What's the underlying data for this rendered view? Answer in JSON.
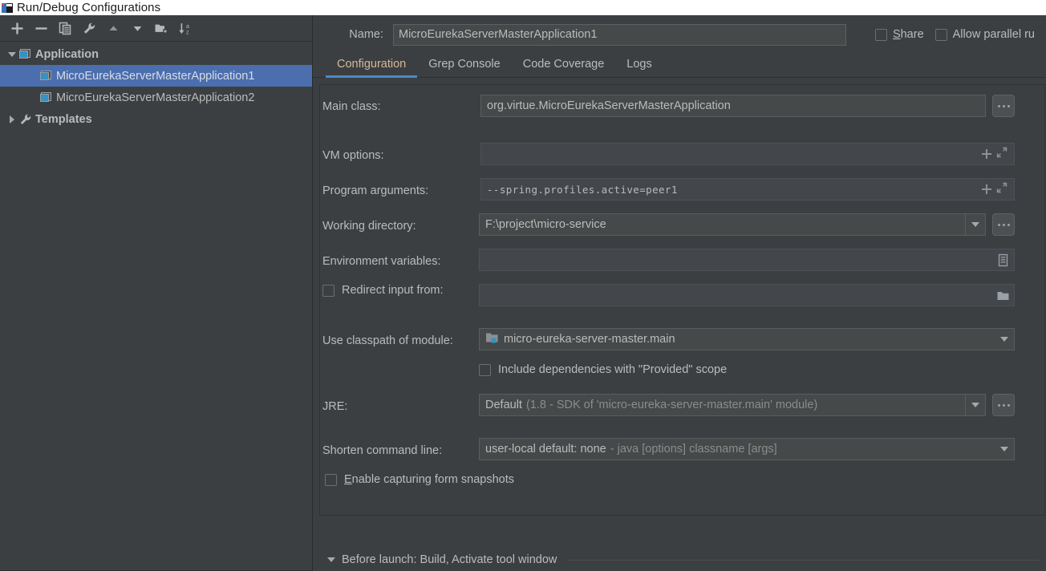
{
  "window": {
    "title": "Run/Debug Configurations",
    "icon": "intellij-idea-icon"
  },
  "toolbar": {
    "buttons": [
      {
        "name": "add-configuration-button",
        "icon": "plus-icon"
      },
      {
        "name": "remove-configuration-button",
        "icon": "minus-icon"
      },
      {
        "name": "copy-configuration-button",
        "icon": "copy-icon"
      },
      {
        "name": "edit-templates-button",
        "icon": "wrench-icon"
      },
      {
        "name": "move-up-button",
        "icon": "arrow-up-icon"
      },
      {
        "name": "move-down-button",
        "icon": "arrow-down-icon"
      },
      {
        "name": "create-folder-button",
        "icon": "folder-add-icon"
      },
      {
        "name": "sort-configurations-button",
        "icon": "sort-az-icon"
      }
    ]
  },
  "tree": {
    "nodes": [
      {
        "label": "Application",
        "type": "group",
        "expanded": true,
        "icon": "application-icon",
        "bold": true
      },
      {
        "label": "MicroEurekaServerMasterApplication1",
        "type": "config",
        "selected": true,
        "icon": "application-icon"
      },
      {
        "label": "MicroEurekaServerMasterApplication2",
        "type": "config",
        "selected": false,
        "icon": "application-icon"
      },
      {
        "label": "Templates",
        "type": "group",
        "expanded": false,
        "icon": "wrench-icon",
        "bold": true
      }
    ]
  },
  "header": {
    "name_label": "Name:",
    "name_value": "MicroEurekaServerMasterApplication1",
    "share_label": "Share",
    "share_mnemonic": "S",
    "share_checked": false,
    "parallel_label": "Allow parallel ru",
    "parallel_checked": false
  },
  "tabs": [
    {
      "label": "Configuration",
      "active": true
    },
    {
      "label": "Grep Console",
      "active": false
    },
    {
      "label": "Code Coverage",
      "active": false
    },
    {
      "label": "Logs",
      "active": false
    }
  ],
  "form": {
    "main_class_label": "Main class:",
    "main_class_value": "org.virtue.MicroEurekaServerMasterApplication",
    "vm_options_label": "VM options:",
    "vm_options_value": "",
    "program_arguments_label": "Program arguments:",
    "program_arguments_value": "--spring.profiles.active=peer1",
    "working_directory_label": "Working directory:",
    "working_directory_value": "F:\\project\\micro-service",
    "environment_variables_label": "Environment variables:",
    "environment_variables_value": "",
    "redirect_input_label": "Redirect input from:",
    "redirect_input_checked": false,
    "redirect_input_value": "",
    "classpath_module_label": "Use classpath of module:",
    "classpath_module_value": "micro-eureka-server-master.main",
    "include_provided_label": "Include dependencies with \"Provided\" scope",
    "include_provided_checked": false,
    "jre_label": "JRE:",
    "jre_value_main": "Default",
    "jre_value_detail": "(1.8 - SDK of 'micro-eureka-server-master.main' module)",
    "shorten_cmd_label": "Shorten command line:",
    "shorten_cmd_value_main": "user-local default: none",
    "shorten_cmd_value_detail": "- java [options] classname [args]",
    "snapshots_label": "nable capturing form snapshots",
    "snapshots_mnemonic": "E",
    "snapshots_checked": false
  },
  "before_launch": {
    "text": "Before launch: Build, Activate tool window",
    "expanded": true
  },
  "colors": {
    "background": "#3c3f41",
    "field_background": "#45494a",
    "selection": "#4b6eaf",
    "accent_tab": "#4a88c7",
    "active_tab_text": "#d4b998",
    "text": "#bbbbbb"
  }
}
